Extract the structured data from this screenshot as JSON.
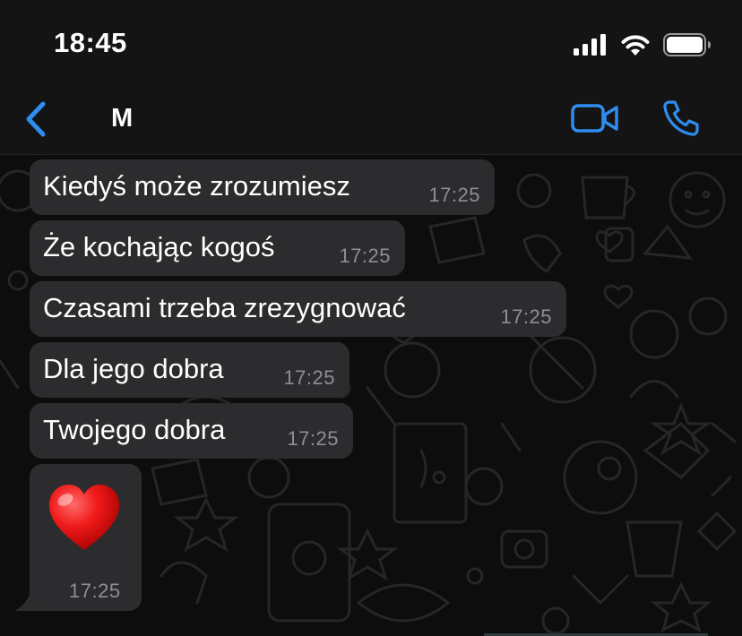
{
  "status_bar": {
    "time": "18:45",
    "icons": [
      "signal-icon",
      "wifi-icon",
      "battery-icon"
    ]
  },
  "nav": {
    "back_icon": "chevron-left-icon",
    "contact_name": "M",
    "video_icon": "video-camera-icon",
    "call_icon": "phone-icon",
    "accent_color": "#2f8cf0"
  },
  "messages": [
    {
      "text": "Kiedyś może zrozumiesz",
      "time": "17:25"
    },
    {
      "text": "Że kochając kogoś",
      "time": "17:25"
    },
    {
      "text": "Czasami trzeba zrezygnować",
      "time": "17:25"
    },
    {
      "text": "Dla jego dobra",
      "time": "17:25"
    },
    {
      "text": "Twojego dobra",
      "time": "17:25"
    },
    {
      "emoji": "red-heart-emoji",
      "time": "17:25"
    }
  ],
  "colors": {
    "bubble": "#2c2c2e",
    "timestamp": "#8e8e93",
    "background": "#0b0b0b"
  }
}
